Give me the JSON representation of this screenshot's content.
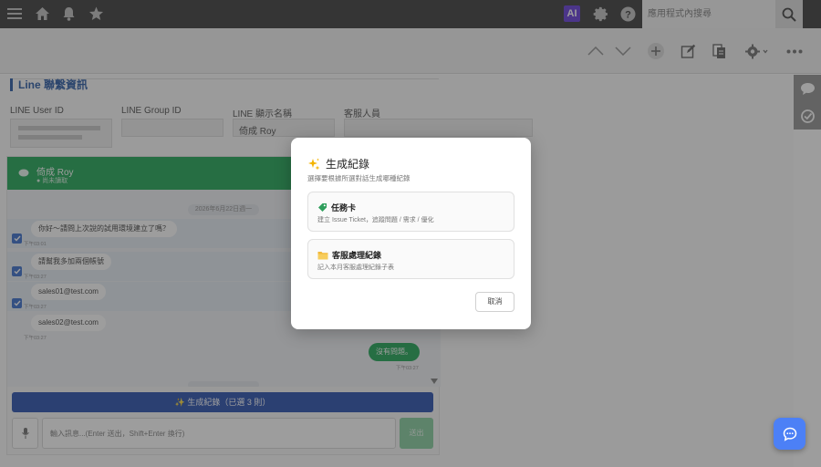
{
  "topbar": {
    "ai_label": "AI",
    "search_placeholder": "應用程式內搜尋"
  },
  "section": {
    "title": "Line 聯繫資訊"
  },
  "fields": {
    "user_id_label": "LINE User ID",
    "user_id_value": "",
    "group_id_label": "LINE Group ID",
    "group_id_value": "",
    "display_name_label": "LINE 顯示名稱",
    "display_name_value": "倚成 Roy",
    "agent_label": "客服人員",
    "agent_value": ""
  },
  "chat": {
    "contact_name": "倚成 Roy",
    "contact_status": "● 尚未讀取",
    "date_divider": "2026年6月22日週一",
    "messages": [
      {
        "text": "你好～請問上次說的試用環境建立了嗎？",
        "time": "下午03:01",
        "checked": true
      },
      {
        "text": "請幫我多加兩個帳號",
        "time": "下午03:27",
        "checked": true
      },
      {
        "text": "sales01@test.com",
        "time": "下午03:27",
        "checked": true
      },
      {
        "text": "sales02@test.com",
        "time": "下午03:27",
        "checked": false
      }
    ],
    "outgoing": {
      "text": "沒有問題。",
      "time": "下午03:27"
    },
    "generate_button": "✨ 生成紀錄（已選 3 則）",
    "input_placeholder": "輸入訊息...(Enter 送出，Shift+Enter 換行)",
    "send_label": "送出"
  },
  "modal": {
    "title": "生成紀錄",
    "subtitle": "選擇要根據所選對話生成哪種紀錄",
    "options": [
      {
        "title": "任務卡",
        "desc": "建立 Issue Ticket，追蹤問題 / 需求 / 優化"
      },
      {
        "title": "客服處理紀錄",
        "desc": "記入本月客服處理紀錄子表"
      }
    ],
    "cancel_label": "取消"
  },
  "colors": {
    "topbar": "#2f2f2f",
    "line_green": "#10a14a",
    "primary_blue": "#1b44a8",
    "fab_blue": "#4c80f6"
  }
}
